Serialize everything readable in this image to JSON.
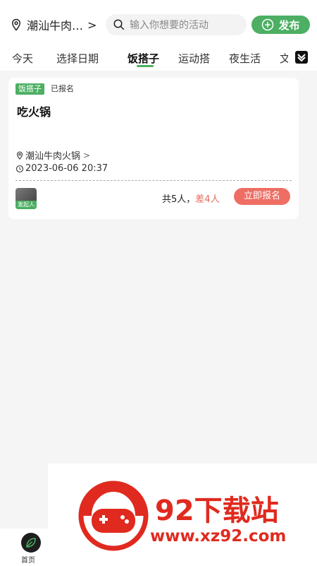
{
  "header": {
    "location": "潮汕牛肉…",
    "location_arrow": ">",
    "search_placeholder": "输入你想要的活动",
    "publish_label": "发布"
  },
  "tabs": [
    {
      "label": "今天",
      "active": false
    },
    {
      "label": "选择日期",
      "active": false
    },
    {
      "label": "饭搭子",
      "active": true
    },
    {
      "label": "运动搭",
      "active": false
    },
    {
      "label": "夜生活",
      "active": false
    },
    {
      "label": "文",
      "active": false
    }
  ],
  "card": {
    "tag": "饭搭子",
    "status": "已报名",
    "title": "吃火锅",
    "address": "潮汕牛肉火锅",
    "address_arrow": ">",
    "datetime": "2023-06-06 20:37",
    "avatar_label": "发起人",
    "people_total": "共5人",
    "people_sep": "，",
    "people_diff": "差4人",
    "join_label": "立即报名"
  },
  "bottom_nav": {
    "home_label": "首页"
  },
  "watermark": {
    "title": "92下载站",
    "url": "www.xz92.com"
  },
  "colors": {
    "accent": "#4caf63",
    "join": "#ee6e64",
    "diff": "#e66b5b",
    "watermark": "#e02a1f"
  }
}
